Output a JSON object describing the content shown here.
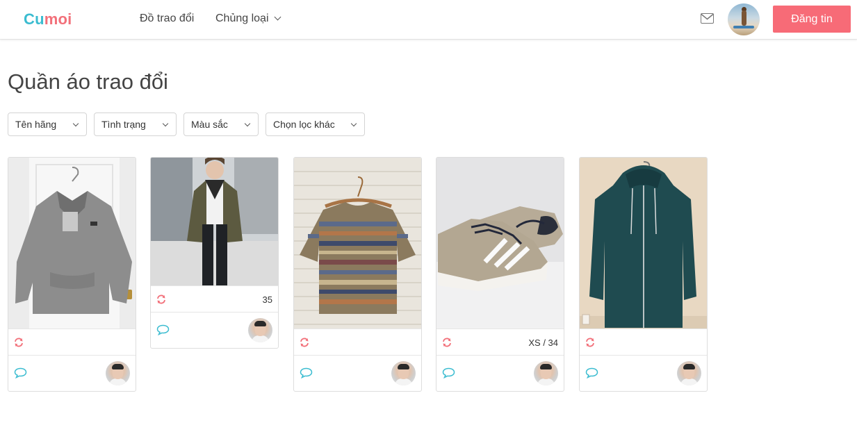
{
  "brand": {
    "part1": "Cu",
    "part2": "moi"
  },
  "nav": {
    "exchange": "Đồ trao đổi",
    "categories": "Chủng loại"
  },
  "header": {
    "post_label": "Đăng tin"
  },
  "page": {
    "title": "Quần áo trao đổi"
  },
  "filters": [
    {
      "label": "Tên hãng"
    },
    {
      "label": "Tình trạng"
    },
    {
      "label": "Màu sắc"
    },
    {
      "label": "Chọn lọc khác"
    }
  ],
  "items": [
    {
      "photo": "grey-sweatshirt",
      "size": ""
    },
    {
      "photo": "olive-bomber-jacket-outfit",
      "size": "35"
    },
    {
      "photo": "striped-knit-tshirt",
      "size": ""
    },
    {
      "photo": "beige-adidas-sneakers",
      "size": "XS / 34"
    },
    {
      "photo": "dark-teal-zip-hoodie",
      "size": ""
    }
  ],
  "colors": {
    "accent": "#f76b77",
    "brand_blue": "#3bbcd0",
    "brand_pink": "#f2707a",
    "chat": "#3bbcd0",
    "swap": "#f2707a"
  },
  "icons": [
    "mail-icon",
    "chevron-down-icon",
    "swap-icon",
    "chat-icon",
    "avatar"
  ]
}
